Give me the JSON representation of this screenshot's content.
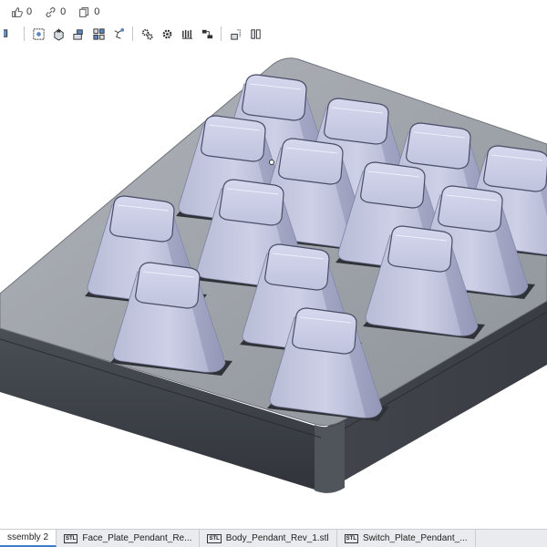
{
  "stats": {
    "likes": "0",
    "links": "0",
    "copies": "0"
  },
  "toolbar": {
    "icons": [
      "assembly-icon",
      "mate-icon",
      "insert-icon",
      "pattern-icon",
      "explode-icon",
      "gear-relation-icon",
      "rack-icon",
      "screw-icon",
      "linear-relation-icon",
      "named-position-icon",
      "replicate-icon"
    ]
  },
  "tabs": [
    {
      "label": "ssembly 2",
      "type": "assembly",
      "active": true
    },
    {
      "label": "Face_Plate_Pendant_Re...",
      "type": "stl",
      "active": false
    },
    {
      "label": "Body_Pendant_Rev_1.stl",
      "type": "stl",
      "active": false
    },
    {
      "label": "Switch_Plate_Pendant_...",
      "type": "stl",
      "active": false
    }
  ],
  "tab_badge": "STL",
  "colors": {
    "body_top": "#9ea3aa",
    "body_side": "#3c4046",
    "keycap": "#c7c9e0"
  }
}
